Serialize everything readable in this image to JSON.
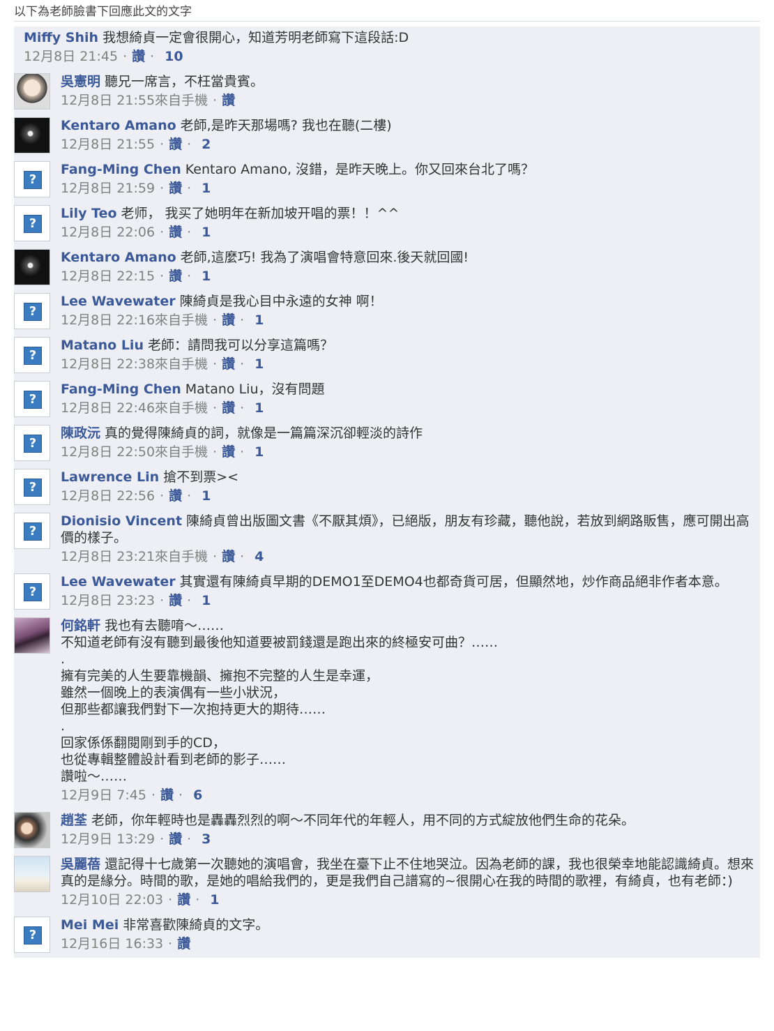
{
  "header": {
    "title": "以下為老師臉書下回應此文的文字"
  },
  "comments": [
    {
      "author": "Miffy Shih",
      "text": "我想綺貞一定會很開心，知道芳明老師寫下這段話:D",
      "time": "12月8日 21:45",
      "like": "讚",
      "count": "10"
    },
    {
      "author": "吳憲明",
      "text": "聽兄一席言，不枉當貴賓。",
      "time": "12月8日 21:55來自手機",
      "like": "讚",
      "count": ""
    },
    {
      "author": "Kentaro Amano",
      "text": "老師,是昨天那場嗎? 我也在聽(二樓)",
      "time": "12月8日 21:55",
      "like": "讚",
      "count": "2"
    },
    {
      "author": "Fang-Ming Chen",
      "text": "Kentaro Amano, 沒錯，是昨天晚上。你又回來台北了嗎？",
      "time": "12月8日 21:59",
      "like": "讚",
      "count": "1"
    },
    {
      "author": "Lily Teo",
      "text": "老师， 我买了她明年在新加坡开唱的票！！^^",
      "time": "12月8日 22:06",
      "like": "讚",
      "count": "1"
    },
    {
      "author": "Kentaro Amano",
      "text": "老師,這麼巧! 我為了演唱會特意回來.後天就回國!",
      "time": "12月8日 22:15",
      "like": "讚",
      "count": "1"
    },
    {
      "author": "Lee Wavewater",
      "text": "陳綺貞是我心目中永遠的女神 啊！",
      "time": "12月8日 22:16來自手機",
      "like": "讚",
      "count": "1"
    },
    {
      "author": "Matano Liu",
      "text": "老師：請問我可以分享這篇嗎？",
      "time": "12月8日 22:38來自手機",
      "like": "讚",
      "count": "1"
    },
    {
      "author": "Fang-Ming Chen",
      "text": "Matano Liu，沒有問題",
      "time": "12月8日 22:46來自手機",
      "like": "讚",
      "count": "1"
    },
    {
      "author": "陳政沅",
      "text": "真的覺得陳綺貞的詞，就像是一篇篇深沉卻輕淡的詩作",
      "time": "12月8日 22:50來自手機",
      "like": "讚",
      "count": "1"
    },
    {
      "author": "Lawrence Lin",
      "text": "搶不到票><",
      "time": "12月8日 22:56",
      "like": "讚",
      "count": "1"
    },
    {
      "author": "Dionisio Vincent",
      "text": "陳綺貞曾出版圖文書《不厭其煩》，已絕版，朋友有珍藏，聽他說，若放到網路販售，應可開出高價的樣子。",
      "time": "12月8日 23:21來自手機",
      "like": "讚",
      "count": "4"
    },
    {
      "author": "Lee Wavewater",
      "text": "其實還有陳綺貞早期的DEMO1至DEMO4也都奇貨可居，但顯然地，炒作商品絕非作者本意。",
      "time": "12月8日 23:23",
      "like": "讚",
      "count": "1"
    },
    {
      "author": "何銘軒",
      "text": "我也有去聽唷～……",
      "extra": [
        "不知道老師有沒有聽到最後他知道要被罰錢還是跑出來的終極安可曲？……",
        ".",
        "擁有完美的人生要靠機韻、擁抱不完整的人生是幸運，",
        "雖然一個晚上的表演偶有一些小狀況，",
        "但那些都讓我們對下一次抱持更大的期待……",
        ".",
        "回家係係翻閱剛到手的CD，",
        "也從專輯整體設計看到老師的影子……",
        "讚啦～……"
      ],
      "time": "12月9日 7:45",
      "like": "讚",
      "count": "6"
    },
    {
      "author": "趙荃",
      "text": "老師，你年輕時也是轟轟烈烈的啊～不同年代的年輕人，用不同的方式綻放他們生命的花朵。",
      "time": "12月9日 13:29",
      "like": "讚",
      "count": "3"
    },
    {
      "author": "吳麗蓓",
      "text": "還記得十七歲第一次聽她的演唱會，我坐在臺下止不住地哭泣。因為老師的課，我也很榮幸地能認識綺貞。想來真的是緣分。時間的歌，是她的唱給我們的，更是我們自己譜寫的~很開心在我的時間的歌裡，有綺貞，也有老師：)",
      "time": "12月10日 22:03",
      "like": "讚",
      "count": "1"
    },
    {
      "author": "Mei Mei",
      "text": "非常喜歡陳綺貞的文字。",
      "time": "12月16日 16:33",
      "like": "讚",
      "count": ""
    }
  ]
}
